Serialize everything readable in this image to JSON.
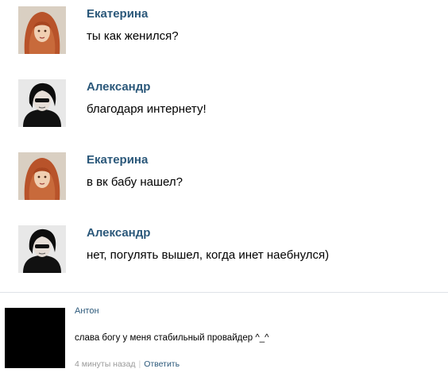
{
  "messages": [
    {
      "author": "Екатерина",
      "text": "ты как женился?",
      "avatar_icon": "red-haired-woman-avatar"
    },
    {
      "author": "Александр",
      "text": "благодаря интернету!",
      "avatar_icon": "dark-haired-man-avatar"
    },
    {
      "author": "Екатерина",
      "text": "в вк бабу нашел?",
      "avatar_icon": "red-haired-woman-avatar"
    },
    {
      "author": "Александр",
      "text": "нет, погулять вышел, когда инет наебнулся)",
      "avatar_icon": "dark-haired-man-avatar"
    }
  ],
  "comment": {
    "author": "Антон",
    "text": "слава богу у меня стабильный провайдер ^_^",
    "time": "4 минуты назад",
    "separator": "|",
    "reply_label": "Ответить",
    "avatar_icon": "black-avatar"
  },
  "colors": {
    "author_link": "#2b587a",
    "meta_gray": "#999999"
  }
}
